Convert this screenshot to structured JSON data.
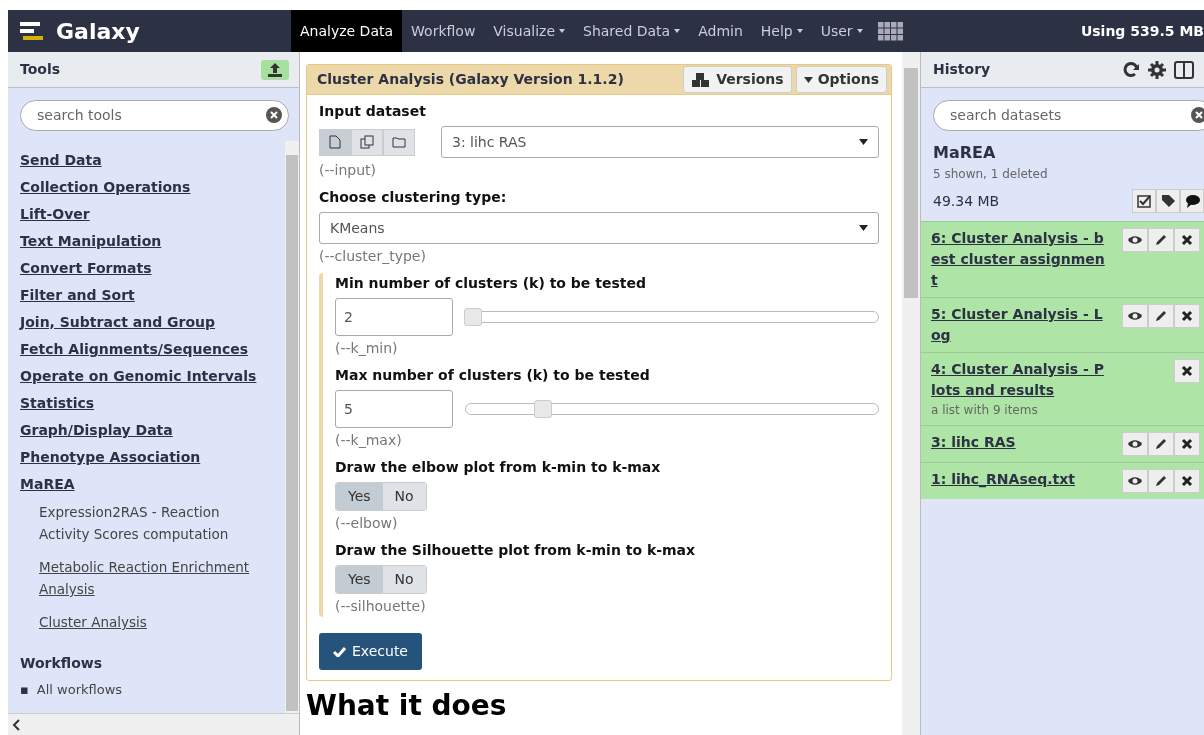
{
  "brand": "Galaxy",
  "nav": [
    {
      "label": "Analyze Data",
      "dropdown": false,
      "selected": true
    },
    {
      "label": "Workflow",
      "dropdown": false,
      "selected": false
    },
    {
      "label": "Visualize",
      "dropdown": true,
      "selected": false
    },
    {
      "label": "Shared Data",
      "dropdown": true,
      "selected": false
    },
    {
      "label": "Admin",
      "dropdown": false,
      "selected": false
    },
    {
      "label": "Help",
      "dropdown": true,
      "selected": false
    },
    {
      "label": "User",
      "dropdown": true,
      "selected": false
    }
  ],
  "quota": "Using 539.5 MB",
  "tools": {
    "title": "Tools",
    "search": {
      "placeholder": "search tools"
    },
    "items": [
      {
        "kind": "category",
        "label": "Send Data"
      },
      {
        "kind": "category",
        "label": "Collection Operations"
      },
      {
        "kind": "category",
        "label": "Lift-Over"
      },
      {
        "kind": "category",
        "label": "Text Manipulation"
      },
      {
        "kind": "category",
        "label": "Convert Formats"
      },
      {
        "kind": "category",
        "label": "Filter and Sort"
      },
      {
        "kind": "category",
        "label": "Join, Subtract and Group"
      },
      {
        "kind": "category",
        "label": "Fetch Alignments/Sequences"
      },
      {
        "kind": "category",
        "label": "Operate on Genomic Intervals"
      },
      {
        "kind": "category",
        "label": "Statistics"
      },
      {
        "kind": "category",
        "label": "Graph/Display Data"
      },
      {
        "kind": "category",
        "label": "Phenotype Association"
      },
      {
        "kind": "category",
        "label": "MaREA"
      },
      {
        "kind": "tool",
        "label": "Expression2RAS",
        "description": "- Reaction Activity Scores computation"
      },
      {
        "kind": "tool",
        "label": "Metabolic Reaction Enrichment Analysis"
      },
      {
        "kind": "tool",
        "label": "Cluster Analysis"
      }
    ],
    "workflows": {
      "title": "Workflows",
      "items": [
        {
          "bullet": "▪",
          "label": "All workflows"
        }
      ]
    }
  },
  "form": {
    "title": "Cluster Analysis (Galaxy Version 1.1.2)",
    "versions": "Versions",
    "options": "Options",
    "input": {
      "label": "Input dataset",
      "sources": [
        {
          "kind": "file",
          "selected": true
        },
        {
          "kind": "files",
          "selected": false
        },
        {
          "kind": "folder",
          "selected": false
        }
      ],
      "value": "3: lihc RAS",
      "help": "(--input)"
    },
    "cluster_type": {
      "label": "Choose clustering type:",
      "value": "KMeans",
      "help": "(--cluster_type)"
    },
    "params": [
      {
        "kind": "slider",
        "label": "Min number of clusters (k) to be tested",
        "value": "2",
        "level": 0,
        "help": "(--k_min)"
      },
      {
        "kind": "slider",
        "label": "Max number of clusters (k) to be tested",
        "value": "5",
        "level": 0.17,
        "help": "(--k_max)"
      },
      {
        "kind": "toggle",
        "label": "Draw the elbow plot from k-min to k-max",
        "options": [
          {
            "label": "Yes",
            "selected": true
          },
          {
            "label": "No",
            "selected": false
          }
        ],
        "help": "(--elbow)"
      },
      {
        "kind": "toggle",
        "label": "Draw the Silhouette plot from k-min to k-max",
        "options": [
          {
            "label": "Yes",
            "selected": true
          },
          {
            "label": "No",
            "selected": false
          }
        ],
        "help": "(--silhouette)"
      }
    ],
    "execute": "Execute"
  },
  "what_it_does": "What it does",
  "history": {
    "title": "History",
    "search": {
      "placeholder": "search datasets"
    },
    "name": "MaREA",
    "shown": "5 shown, 1",
    "deleted": "deleted",
    "size": "49.34 MB",
    "items": [
      {
        "title": "6: Cluster Analysis - best cluster assignment",
        "actions": [
          {
            "kind": "view"
          },
          {
            "kind": "edit"
          },
          {
            "kind": "delete"
          }
        ]
      },
      {
        "title": "5: Cluster Analysis - Log",
        "actions": [
          {
            "kind": "view"
          },
          {
            "kind": "edit"
          },
          {
            "kind": "delete"
          }
        ]
      },
      {
        "title": "4: Cluster Analysis - Plots and results",
        "actions": [
          {
            "kind": "delete"
          }
        ],
        "subtitle": "a list with 9 items"
      },
      {
        "title": "3: lihc RAS",
        "actions": [
          {
            "kind": "view"
          },
          {
            "kind": "edit"
          },
          {
            "kind": "delete"
          }
        ]
      },
      {
        "title": "1: lihc_RNAseq.txt",
        "actions": [
          {
            "kind": "view"
          },
          {
            "kind": "edit"
          },
          {
            "kind": "delete"
          }
        ]
      }
    ]
  }
}
